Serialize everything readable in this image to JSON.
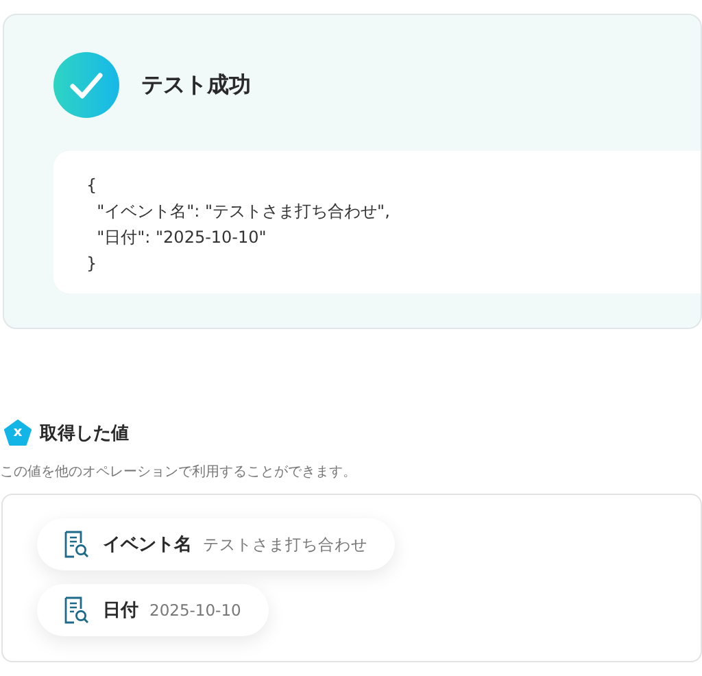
{
  "result": {
    "title": "テスト成功",
    "success": true,
    "code_lines": [
      "{",
      "  \"イベント名\": \"テストさま打ち合わせ\",",
      "  \"日付\": \"2025-10-10\"",
      "}"
    ]
  },
  "values_section": {
    "badge": "x",
    "heading": "取得した値",
    "description": "この値を他のオペレーションで利用することができます。",
    "items": [
      {
        "name": "イベント名",
        "value": "テストさま打ち合わせ"
      },
      {
        "name": "日付",
        "value": "2025-10-10"
      }
    ]
  }
}
